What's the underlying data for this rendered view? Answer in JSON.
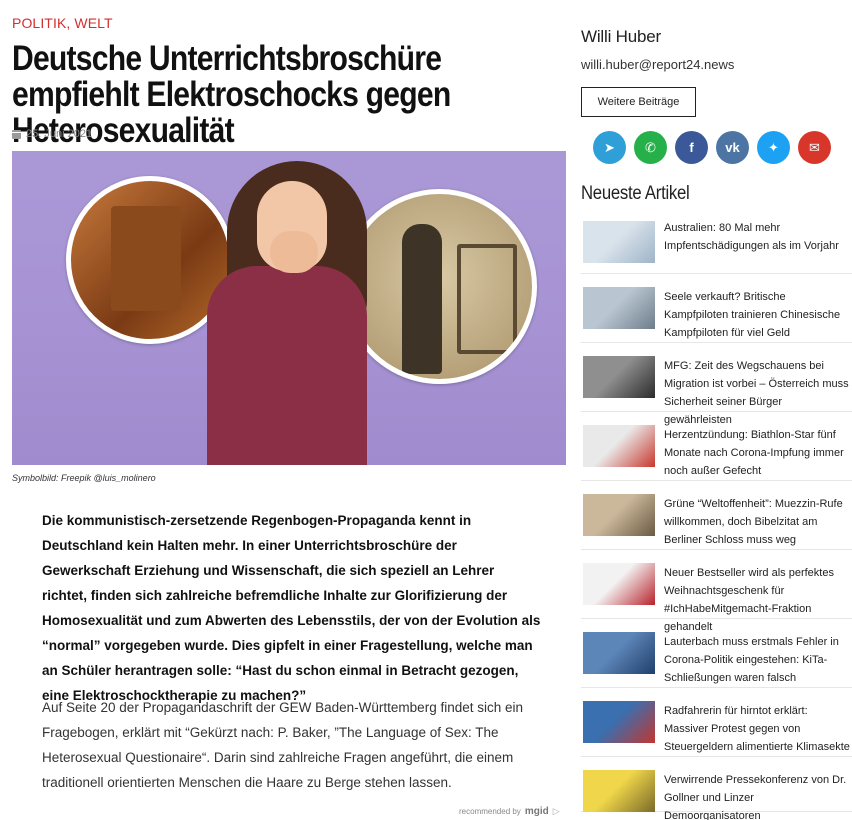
{
  "article": {
    "categories": [
      "POLITIK",
      "WELT"
    ],
    "category_separator": ", ",
    "title": "Deutsche Unterrichtsbroschüre empfiehlt Elektroschocks gegen Heterosexualität",
    "date": "25. Juni 2021",
    "image_caption": "Symbolbild: Freepik @luis_molinero",
    "lead": "Die kommunistisch-zersetzende Regenbogen-Propaganda kennt in Deutschland kein Halten mehr. In einer Unterrichtsbroschüre der Gewerkschaft Erziehung und Wissenschaft, die sich speziell an Lehrer richtet, finden sich zahlreiche befremdliche Inhalte zur Glorifizierung der Homosexualität und zum Abwerten des Lebensstils, der von der Evolution als “normal” vorgegeben wurde. Dies gipfelt in einer Fragestellung, welche man an Schüler herantragen solle: “Hast du schon einmal in Betracht gezogen, eine Elektroschocktherapie zu machen?”",
    "body": "Auf Seite 20 der Propagandaschrift der GEW Baden-Württemberg findet sich ein Fragebogen, erklärt mit “Gekürzt nach: P. Baker, ”The Language of Sex: The Heterosexual Questionaire“. Darin sind zahlreiche Fragen angeführt, die einem traditionell orientierten Menschen die Haare zu Berge stehen lassen.",
    "recommended": {
      "prefix": "recommended by",
      "brand": "mgid",
      "ad_icon": "▷"
    }
  },
  "sidebar": {
    "author_name": "Willi Huber",
    "author_email": "willi.huber@report24.news",
    "more_button": "Weitere Beiträge",
    "socials": [
      {
        "icon": "telegram-icon",
        "glyph": "➤",
        "color": "#2f9fd7"
      },
      {
        "icon": "whatsapp-icon",
        "glyph": "✆",
        "color": "#25b04a"
      },
      {
        "icon": "facebook-icon",
        "glyph": "f",
        "color": "#3b5998"
      },
      {
        "icon": "vk-icon",
        "glyph": "vk",
        "color": "#4c75a3"
      },
      {
        "icon": "twitter-icon",
        "glyph": "✦",
        "color": "#1da1f2"
      },
      {
        "icon": "email-icon",
        "glyph": "✉",
        "color": "#d9362b"
      }
    ],
    "latest_heading": "Neueste Artikel",
    "latest": [
      {
        "title": "Australien: 80 Mal mehr Impfentschädigungen als im Vorjahr",
        "thumb": [
          "#d9e3ec",
          "#9fb4c7"
        ]
      },
      {
        "title": "Seele verkauft? Britische Kampfpiloten trainieren Chinesische Kampfpiloten für viel Geld",
        "thumb": [
          "#b9c6d2",
          "#6e7d8a"
        ]
      },
      {
        "title": "MFG: Zeit des Wegschauens bei Migration ist vorbei – Österreich muss Sicherheit seiner Bürger gewährleisten",
        "thumb": [
          "#8f8f8f",
          "#2b2b2b"
        ]
      },
      {
        "title": "Herzentzündung: Biathlon-Star fünf Monate nach Corona-Impfung immer noch außer Gefecht",
        "thumb": [
          "#e9e9e9",
          "#c8372d"
        ]
      },
      {
        "title": "Grüne “Weltoffenheit”: Muezzin-Rufe willkommen, doch Bibelzitat am Berliner Schloss muss weg",
        "thumb": [
          "#cbb89a",
          "#6a5a44"
        ]
      },
      {
        "title": "Neuer Bestseller wird als perfektes Weihnachtsgeschenk für #IchHabeMitgemacht-Fraktion gehandelt",
        "thumb": [
          "#f2f2f2",
          "#b8222a"
        ]
      },
      {
        "title": "Lauterbach muss erstmals Fehler in Corona-Politik eingestehen: KiTa-Schließungen waren falsch",
        "thumb": [
          "#5d86b8",
          "#1f3f6b"
        ]
      },
      {
        "title": "Radfahrerin für hirntot erklärt: Massiver Protest gegen von Steuergeldern alimentierte Klimasekte",
        "thumb": [
          "#3a6fb0",
          "#c2362f"
        ]
      },
      {
        "title": "Verwirrende Pressekonferenz von Dr. Gollner und Linzer Demoorganisatoren",
        "thumb": [
          "#f0d64a",
          "#7a6a2a"
        ]
      }
    ]
  }
}
